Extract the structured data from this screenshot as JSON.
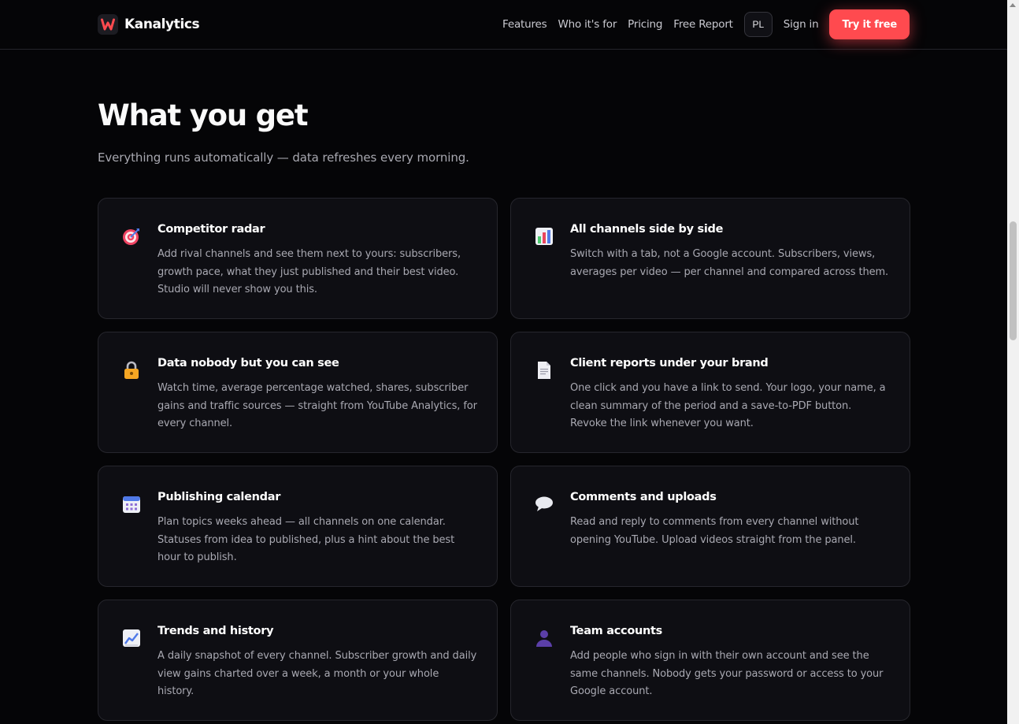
{
  "brand": {
    "name": "Kanalytics",
    "logo_icon": "kanalytics-logo-icon",
    "logo_color": "#ff4a4f"
  },
  "nav": {
    "links": [
      "Features",
      "Who it's for",
      "Pricing",
      "Free Report"
    ],
    "language": "PL",
    "signin": "Sign in",
    "cta": "Try it free"
  },
  "section": {
    "title": "What you get",
    "subtitle": "Everything runs automatically — data refreshes every morning."
  },
  "features": [
    {
      "icon": "target-icon",
      "title": "Competitor radar",
      "desc": "Add rival channels and see them next to yours: subscribers, growth pace, what they just published and their best video. Studio will never show you this."
    },
    {
      "icon": "bar-chart-icon",
      "title": "All channels side by side",
      "desc": "Switch with a tab, not a Google account. Subscribers, views, averages per video — per channel and compared across them."
    },
    {
      "icon": "lock-icon",
      "title": "Data nobody but you can see",
      "desc": "Watch time, average percentage watched, shares, subscriber gains and traffic sources — straight from YouTube Analytics, for every channel."
    },
    {
      "icon": "document-icon",
      "title": "Client reports under your brand",
      "desc": "One click and you have a link to send. Your logo, your name, a clean summary of the period and a save-to-PDF button. Revoke the link whenever you want."
    },
    {
      "icon": "calendar-icon",
      "title": "Publishing calendar",
      "desc": "Plan topics weeks ahead — all channels on one calendar. Statuses from idea to published, plus a hint about the best hour to publish."
    },
    {
      "icon": "speech-bubble-icon",
      "title": "Comments and uploads",
      "desc": "Read and reply to comments from every channel without opening YouTube. Upload videos straight from the panel."
    },
    {
      "icon": "trend-chart-icon",
      "title": "Trends and history",
      "desc": "A daily snapshot of every channel. Subscriber growth and daily view gains charted over a week, a month or your whole history."
    },
    {
      "icon": "user-silhouette-icon",
      "title": "Team accounts",
      "desc": "Add people who sign in with their own account and see the same channels. Nobody gets your password or access to your Google account."
    }
  ]
}
